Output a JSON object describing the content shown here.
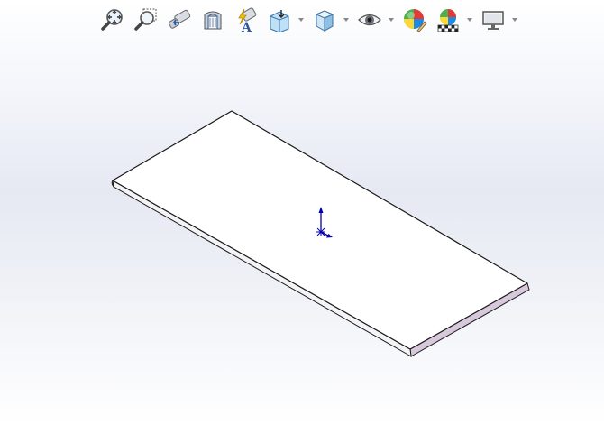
{
  "toolbar": {
    "items": [
      {
        "icon": "zoom-to-fit-icon",
        "dropdown": false
      },
      {
        "icon": "zoom-to-area-icon",
        "dropdown": false
      },
      {
        "icon": "previous-view-icon",
        "dropdown": false
      },
      {
        "icon": "section-view-icon",
        "dropdown": false
      },
      {
        "icon": "dynamic-annotation-views-icon",
        "dropdown": false
      },
      {
        "icon": "view-orientation-icon",
        "dropdown": true
      },
      {
        "icon": "display-style-icon",
        "dropdown": true
      },
      {
        "icon": "hide-show-items-icon",
        "dropdown": true
      },
      {
        "icon": "edit-appearance-icon",
        "dropdown": false
      },
      {
        "icon": "apply-scene-icon",
        "dropdown": true
      },
      {
        "icon": "view-settings-icon",
        "dropdown": true
      }
    ]
  },
  "colors": {
    "background_top": "#ffffff",
    "background_mid": "#e6e9f2",
    "part_face": "#ffffff",
    "part_edge": "#1a1a1a",
    "part_side_shade": "#d8c8dc",
    "triad_color": "#0000aa"
  }
}
